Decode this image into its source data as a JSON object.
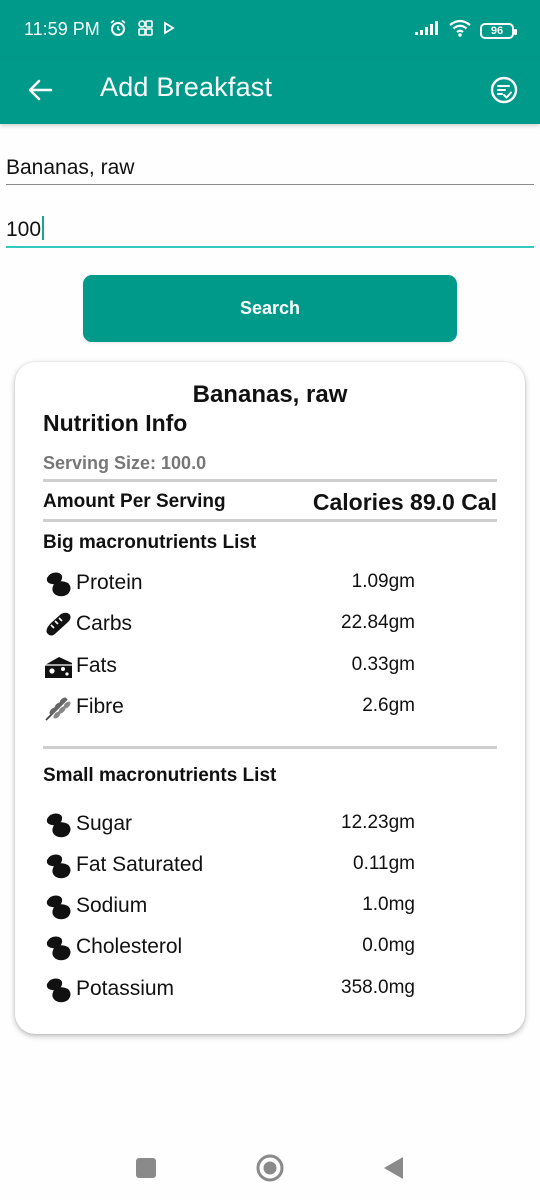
{
  "status_bar": {
    "time": "11:59 PM",
    "battery": "96"
  },
  "app_bar": {
    "title": "Add Breakfast"
  },
  "form": {
    "food_value": "Bananas, raw",
    "quantity_value": "100",
    "search_label": "Search"
  },
  "card": {
    "food_name": "Bananas, raw",
    "nutrition_heading": "Nutrition Info",
    "serving_size": "Serving Size: 100.0",
    "amount_label": "Amount Per Serving",
    "calories": "Calories 89.0 Cal",
    "big_heading": "Big macronutrients List",
    "big_items": [
      {
        "name": "Protein",
        "value": "1.09gm",
        "icon": "food-icon"
      },
      {
        "name": "Carbs",
        "value": "22.84gm",
        "icon": "bread-icon"
      },
      {
        "name": "Fats",
        "value": "0.33gm",
        "icon": "cheese-icon"
      },
      {
        "name": "Fibre",
        "value": "2.6gm",
        "icon": "wheat-icon"
      }
    ],
    "small_heading": "Small macronutrients List",
    "small_items": [
      {
        "name": "Sugar",
        "value": "12.23gm",
        "icon": "food-icon"
      },
      {
        "name": "Fat Saturated",
        "value": "0.11gm",
        "icon": "food-icon"
      },
      {
        "name": "Sodium",
        "value": "1.0mg",
        "icon": "food-icon"
      },
      {
        "name": "Cholesterol",
        "value": "0.0mg",
        "icon": "food-icon"
      },
      {
        "name": "Potassium",
        "value": "358.0mg",
        "icon": "food-icon"
      }
    ]
  },
  "colors": {
    "primary": "#009a8a",
    "input_focus": "#34c9be"
  }
}
